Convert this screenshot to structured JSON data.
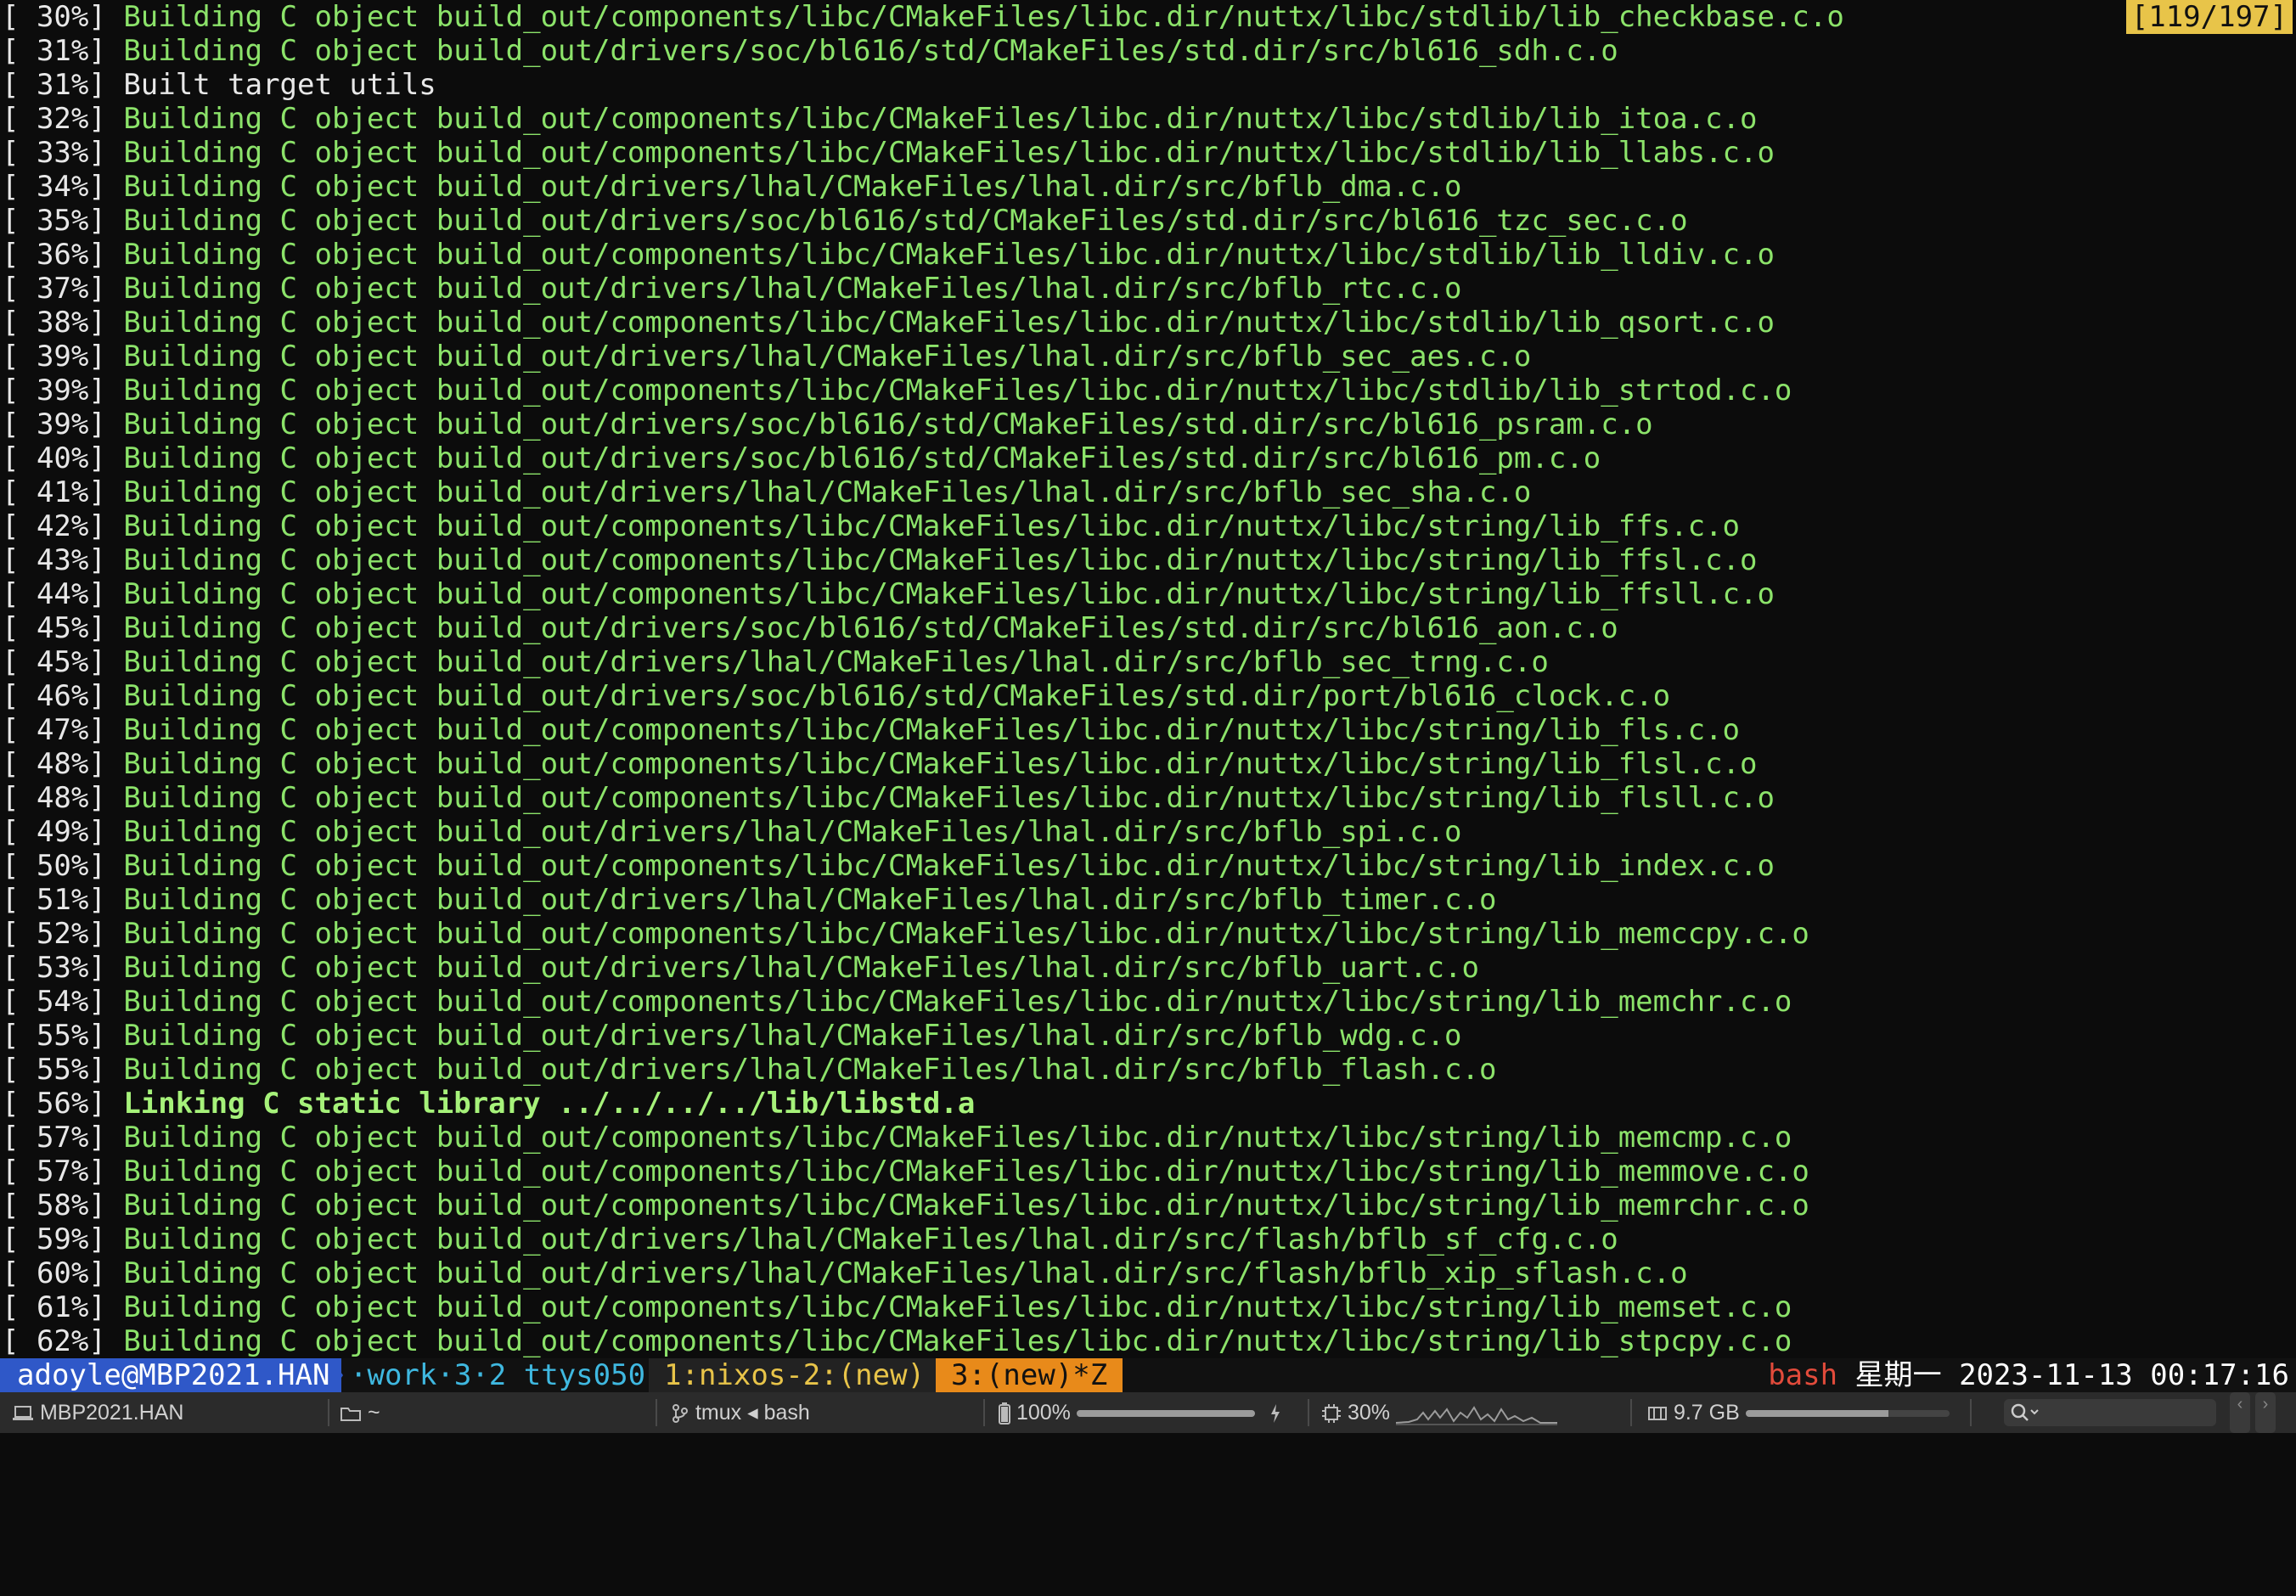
{
  "terminal": {
    "position_indicator": "[119/197]",
    "lines": [
      {
        "pct": "[ 30%]",
        "msg": "Building C object build_out/components/libc/CMakeFiles/libc.dir/nuttx/libc/stdlib/lib_checkbase.c.o",
        "style": "normal"
      },
      {
        "pct": "[ 31%]",
        "msg": "Building C object build_out/drivers/soc/bl616/std/CMakeFiles/std.dir/src/bl616_sdh.c.o",
        "style": "normal"
      },
      {
        "pct": "[ 31%]",
        "msg": "Built target utils",
        "style": "white"
      },
      {
        "pct": "[ 32%]",
        "msg": "Building C object build_out/components/libc/CMakeFiles/libc.dir/nuttx/libc/stdlib/lib_itoa.c.o",
        "style": "normal"
      },
      {
        "pct": "[ 33%]",
        "msg": "Building C object build_out/components/libc/CMakeFiles/libc.dir/nuttx/libc/stdlib/lib_llabs.c.o",
        "style": "normal"
      },
      {
        "pct": "[ 34%]",
        "msg": "Building C object build_out/drivers/lhal/CMakeFiles/lhal.dir/src/bflb_dma.c.o",
        "style": "normal"
      },
      {
        "pct": "[ 35%]",
        "msg": "Building C object build_out/drivers/soc/bl616/std/CMakeFiles/std.dir/src/bl616_tzc_sec.c.o",
        "style": "normal"
      },
      {
        "pct": "[ 36%]",
        "msg": "Building C object build_out/components/libc/CMakeFiles/libc.dir/nuttx/libc/stdlib/lib_lldiv.c.o",
        "style": "normal"
      },
      {
        "pct": "[ 37%]",
        "msg": "Building C object build_out/drivers/lhal/CMakeFiles/lhal.dir/src/bflb_rtc.c.o",
        "style": "normal"
      },
      {
        "pct": "[ 38%]",
        "msg": "Building C object build_out/components/libc/CMakeFiles/libc.dir/nuttx/libc/stdlib/lib_qsort.c.o",
        "style": "normal"
      },
      {
        "pct": "[ 39%]",
        "msg": "Building C object build_out/drivers/lhal/CMakeFiles/lhal.dir/src/bflb_sec_aes.c.o",
        "style": "normal"
      },
      {
        "pct": "[ 39%]",
        "msg": "Building C object build_out/components/libc/CMakeFiles/libc.dir/nuttx/libc/stdlib/lib_strtod.c.o",
        "style": "normal"
      },
      {
        "pct": "[ 39%]",
        "msg": "Building C object build_out/drivers/soc/bl616/std/CMakeFiles/std.dir/src/bl616_psram.c.o",
        "style": "normal"
      },
      {
        "pct": "[ 40%]",
        "msg": "Building C object build_out/drivers/soc/bl616/std/CMakeFiles/std.dir/src/bl616_pm.c.o",
        "style": "normal"
      },
      {
        "pct": "[ 41%]",
        "msg": "Building C object build_out/drivers/lhal/CMakeFiles/lhal.dir/src/bflb_sec_sha.c.o",
        "style": "normal"
      },
      {
        "pct": "[ 42%]",
        "msg": "Building C object build_out/components/libc/CMakeFiles/libc.dir/nuttx/libc/string/lib_ffs.c.o",
        "style": "normal"
      },
      {
        "pct": "[ 43%]",
        "msg": "Building C object build_out/components/libc/CMakeFiles/libc.dir/nuttx/libc/string/lib_ffsl.c.o",
        "style": "normal"
      },
      {
        "pct": "[ 44%]",
        "msg": "Building C object build_out/components/libc/CMakeFiles/libc.dir/nuttx/libc/string/lib_ffsll.c.o",
        "style": "normal"
      },
      {
        "pct": "[ 45%]",
        "msg": "Building C object build_out/drivers/soc/bl616/std/CMakeFiles/std.dir/src/bl616_aon.c.o",
        "style": "normal"
      },
      {
        "pct": "[ 45%]",
        "msg": "Building C object build_out/drivers/lhal/CMakeFiles/lhal.dir/src/bflb_sec_trng.c.o",
        "style": "normal"
      },
      {
        "pct": "[ 46%]",
        "msg": "Building C object build_out/drivers/soc/bl616/std/CMakeFiles/std.dir/port/bl616_clock.c.o",
        "style": "normal"
      },
      {
        "pct": "[ 47%]",
        "msg": "Building C object build_out/components/libc/CMakeFiles/libc.dir/nuttx/libc/string/lib_fls.c.o",
        "style": "normal"
      },
      {
        "pct": "[ 48%]",
        "msg": "Building C object build_out/components/libc/CMakeFiles/libc.dir/nuttx/libc/string/lib_flsl.c.o",
        "style": "normal"
      },
      {
        "pct": "[ 48%]",
        "msg": "Building C object build_out/components/libc/CMakeFiles/libc.dir/nuttx/libc/string/lib_flsll.c.o",
        "style": "normal"
      },
      {
        "pct": "[ 49%]",
        "msg": "Building C object build_out/drivers/lhal/CMakeFiles/lhal.dir/src/bflb_spi.c.o",
        "style": "normal"
      },
      {
        "pct": "[ 50%]",
        "msg": "Building C object build_out/components/libc/CMakeFiles/libc.dir/nuttx/libc/string/lib_index.c.o",
        "style": "normal"
      },
      {
        "pct": "[ 51%]",
        "msg": "Building C object build_out/drivers/lhal/CMakeFiles/lhal.dir/src/bflb_timer.c.o",
        "style": "normal"
      },
      {
        "pct": "[ 52%]",
        "msg": "Building C object build_out/components/libc/CMakeFiles/libc.dir/nuttx/libc/string/lib_memccpy.c.o",
        "style": "normal"
      },
      {
        "pct": "[ 53%]",
        "msg": "Building C object build_out/drivers/lhal/CMakeFiles/lhal.dir/src/bflb_uart.c.o",
        "style": "normal"
      },
      {
        "pct": "[ 54%]",
        "msg": "Building C object build_out/components/libc/CMakeFiles/libc.dir/nuttx/libc/string/lib_memchr.c.o",
        "style": "normal"
      },
      {
        "pct": "[ 55%]",
        "msg": "Building C object build_out/drivers/lhal/CMakeFiles/lhal.dir/src/bflb_wdg.c.o",
        "style": "normal"
      },
      {
        "pct": "[ 55%]",
        "msg": "Building C object build_out/drivers/lhal/CMakeFiles/lhal.dir/src/bflb_flash.c.o",
        "style": "normal"
      },
      {
        "pct": "[ 56%]",
        "msg": "Linking C static library ../../../../lib/libstd.a",
        "style": "bold"
      },
      {
        "pct": "[ 57%]",
        "msg": "Building C object build_out/components/libc/CMakeFiles/libc.dir/nuttx/libc/string/lib_memcmp.c.o",
        "style": "normal"
      },
      {
        "pct": "[ 57%]",
        "msg": "Building C object build_out/components/libc/CMakeFiles/libc.dir/nuttx/libc/string/lib_memmove.c.o",
        "style": "normal"
      },
      {
        "pct": "[ 58%]",
        "msg": "Building C object build_out/components/libc/CMakeFiles/libc.dir/nuttx/libc/string/lib_memrchr.c.o",
        "style": "normal"
      },
      {
        "pct": "[ 59%]",
        "msg": "Building C object build_out/drivers/lhal/CMakeFiles/lhal.dir/src/flash/bflb_sf_cfg.c.o",
        "style": "normal"
      },
      {
        "pct": "[ 60%]",
        "msg": "Building C object build_out/drivers/lhal/CMakeFiles/lhal.dir/src/flash/bflb_xip_sflash.c.o",
        "style": "normal"
      },
      {
        "pct": "[ 61%]",
        "msg": "Building C object build_out/components/libc/CMakeFiles/libc.dir/nuttx/libc/string/lib_memset.c.o",
        "style": "normal"
      },
      {
        "pct": "[ 62%]",
        "msg": "Building C object build_out/components/libc/CMakeFiles/libc.dir/nuttx/libc/string/lib_stpcpy.c.o",
        "style": "normal"
      }
    ]
  },
  "tmux": {
    "session": "adoyle@MBP2021.HAN",
    "work_prefix": "·",
    "work": "work",
    "panes": "·3·2",
    "tty": "ttys050",
    "window_1": "1:nixos-2:(new)",
    "window_3": "3:(new)*Z",
    "shell": "bash",
    "weekday": "星期一",
    "datetime": "2023-11-13 00:17:16",
    "colors": {
      "session_bg": "#2f58c8",
      "active_window_bg": "#e88a1a",
      "window_fg": "#e8c449",
      "shell_fg": "#e24b3b",
      "indicator_bg": "#e8c449",
      "build_text": "#8ce36a"
    }
  },
  "menubar": {
    "host_label": "MBP2021.HAN",
    "host_icon": "laptop-icon",
    "folder_label": "~",
    "folder_icon": "folder-icon",
    "session_label": "tmux ◂ bash",
    "session_icon": "branch-icon",
    "battery_label": "100%",
    "battery_level": 1.0,
    "battery_icon": "battery-icon",
    "charging_icon": "bolt-icon",
    "cpu_label": "30%",
    "cpu_icon": "cpu-icon",
    "memory_label": "9.7 GB",
    "memory_level": 0.7,
    "memory_icon": "memory-icon",
    "search_icon": "search-icon",
    "back_glyph": "‹",
    "forward_glyph": "›"
  }
}
